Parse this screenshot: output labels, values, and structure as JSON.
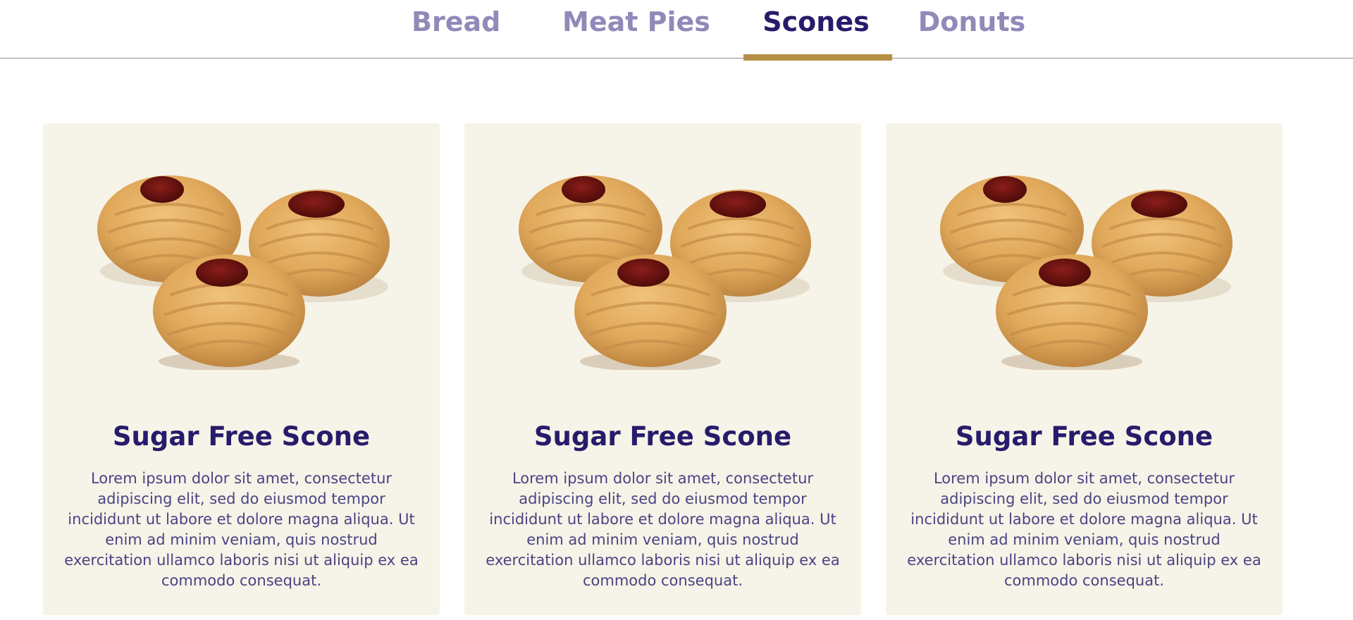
{
  "tabs": [
    {
      "label": "Bread",
      "active": false
    },
    {
      "label": "Meat Pies",
      "active": false
    },
    {
      "label": "Scones",
      "active": true
    },
    {
      "label": "Donuts",
      "active": false
    }
  ],
  "colors": {
    "active_tab": "#271b6b",
    "inactive_tab": "#8f8ab8",
    "tab_indicator": "#b58f45",
    "card_background": "#f6f3e8",
    "body_text": "#4a4383"
  },
  "cards": [
    {
      "image_icon": "jam-cookies-image",
      "title": "Sugar Free Scone",
      "description": "Lorem ipsum dolor sit amet, consectetur adipiscing elit, sed do eiusmod tempor incididunt ut labore et dolore magna aliqua. Ut enim ad minim veniam, quis nostrud exercitation ullamco laboris nisi ut aliquip ex ea commodo consequat."
    },
    {
      "image_icon": "jam-cookies-image",
      "title": "Sugar Free Scone",
      "description": "Lorem ipsum dolor sit amet, consectetur adipiscing elit, sed do eiusmod tempor incididunt ut labore et dolore magna aliqua. Ut enim ad minim veniam, quis nostrud exercitation ullamco laboris nisi ut aliquip ex ea commodo consequat."
    },
    {
      "image_icon": "jam-cookies-image",
      "title": "Sugar Free Scone",
      "description": "Lorem ipsum dolor sit amet, consectetur adipiscing elit, sed do eiusmod tempor incididunt ut labore et dolore magna aliqua. Ut enim ad minim veniam, quis nostrud exercitation ullamco laboris nisi ut aliquip ex ea commodo consequat."
    }
  ]
}
